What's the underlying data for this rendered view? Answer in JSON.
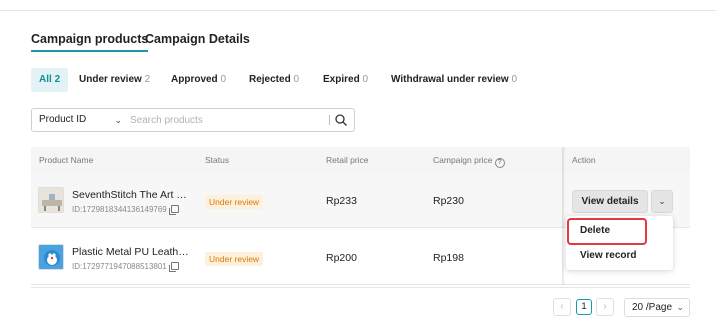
{
  "tabs": [
    "Campaign products",
    "Campaign Details"
  ],
  "filters": [
    {
      "label": "All",
      "count": "2"
    },
    {
      "label": "Under review",
      "count": "2"
    },
    {
      "label": "Approved",
      "count": "0"
    },
    {
      "label": "Rejected",
      "count": "0"
    },
    {
      "label": "Expired",
      "count": "0"
    },
    {
      "label": "Withdrawal under review",
      "count": "0"
    }
  ],
  "search": {
    "field": "Product ID",
    "placeholder": "Search products"
  },
  "columns": [
    "Product Name",
    "Status",
    "Retail price",
    "Campaign price",
    "Action"
  ],
  "rows": [
    {
      "name": "SeventhStitch The Art of Dining Table Runner",
      "id": "ID:1729818344136149769",
      "status": "Under review",
      "retail": "Rp233",
      "campaign": "Rp230"
    },
    {
      "name": "Plastic Metal PU Leather Phone Case",
      "id": "ID:1729771947088513801",
      "status": "Under review",
      "retail": "Rp200",
      "campaign": "Rp198"
    }
  ],
  "action": {
    "view_details": "View details",
    "menu": [
      "Delete",
      "View record"
    ]
  },
  "pagination": {
    "current": "1",
    "per_page": "20 /Page"
  },
  "colors": {
    "accent": "#1a9aa9",
    "status": "#d97a00",
    "highlight": "#e0393e"
  },
  "icons": [
    "chevron-down-icon",
    "search-icon",
    "help-icon",
    "copy-icon",
    "chevron-left-icon",
    "chevron-right-icon"
  ]
}
